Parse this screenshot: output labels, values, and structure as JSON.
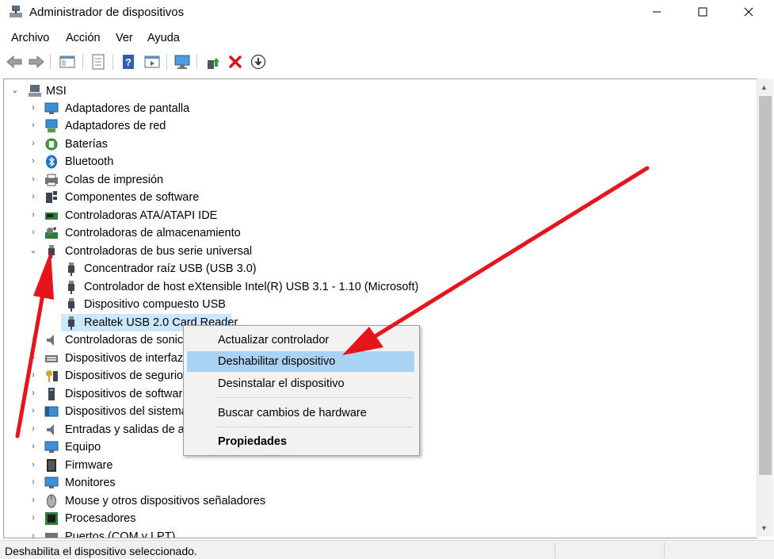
{
  "window": {
    "title": "Administrador de dispositivos"
  },
  "menu": [
    "Archivo",
    "Acción",
    "Ver",
    "Ayuda"
  ],
  "tree": {
    "root": "MSI",
    "categories": [
      {
        "label": "Adaptadores de pantalla",
        "icon": "display-adapter-icon"
      },
      {
        "label": "Adaptadores de red",
        "icon": "network-adapter-icon"
      },
      {
        "label": "Baterías",
        "icon": "battery-icon"
      },
      {
        "label": "Bluetooth",
        "icon": "bluetooth-icon"
      },
      {
        "label": "Colas de impresión",
        "icon": "printer-icon"
      },
      {
        "label": "Componentes de software",
        "icon": "software-component-icon"
      },
      {
        "label": "Controladoras ATA/ATAPI IDE",
        "icon": "ide-controller-icon"
      },
      {
        "label": "Controladoras de almacenamiento",
        "icon": "storage-controller-icon"
      },
      {
        "label": "Controladoras de bus serie universal",
        "icon": "usb-icon"
      }
    ],
    "usb_children": [
      "Concentrador raíz USB (USB 3.0)",
      "Controlador de host eXtensible Intel(R) USB 3.1 - 1.10 (Microsoft)",
      "Dispositivo compuesto USB",
      "Realtek USB 2.0 Card Reader"
    ],
    "more_categories": [
      {
        "label": "Controladoras de sonido, vídeo y dispositivos de juego",
        "visible": "Controladoras de sonic",
        "icon": "sound-icon"
      },
      {
        "label": "Dispositivos de interfaz",
        "visible": "Dispositivos de interfaz",
        "icon": "hid-icon"
      },
      {
        "label": "Dispositivos de seguridad",
        "visible": "Dispositivos de segurio",
        "icon": "security-device-icon"
      },
      {
        "label": "Dispositivos de software",
        "visible": "Dispositivos de softwar",
        "icon": "software-device-icon"
      },
      {
        "label": "Dispositivos del sistema",
        "visible": "Dispositivos del sistema",
        "icon": "system-device-icon"
      },
      {
        "label": "Entradas y salidas de audio",
        "visible": "Entradas y salidas de au",
        "icon": "audio-io-icon"
      },
      {
        "label": "Equipo",
        "visible": "Equipo",
        "icon": "computer-icon"
      },
      {
        "label": "Firmware",
        "visible": "Firmware",
        "icon": "firmware-icon"
      },
      {
        "label": "Monitores",
        "visible": "Monitores",
        "icon": "monitor-icon"
      },
      {
        "label": "Mouse y otros dispositivos señaladores",
        "visible": "Mouse y otros dispositivos señaladores",
        "icon": "mouse-icon"
      },
      {
        "label": "Procesadores",
        "visible": "Procesadores",
        "icon": "processor-icon"
      },
      {
        "label": "Puertos (COM y LPT)",
        "visible": "Puertos (COM y LPT)",
        "icon": "port-icon"
      }
    ]
  },
  "context_menu": {
    "items": [
      "Actualizar controlador",
      "Deshabilitar dispositivo",
      "Desinstalar el dispositivo",
      "Buscar cambios de hardware",
      "Propiedades"
    ],
    "highlighted": "Deshabilitar dispositivo"
  },
  "status": "Deshabilita el dispositivo seleccionado.",
  "colors": {
    "selection": "#cce8ff",
    "menu_highlight": "#a9d3f5",
    "annotation_arrow": "#e8141c"
  }
}
